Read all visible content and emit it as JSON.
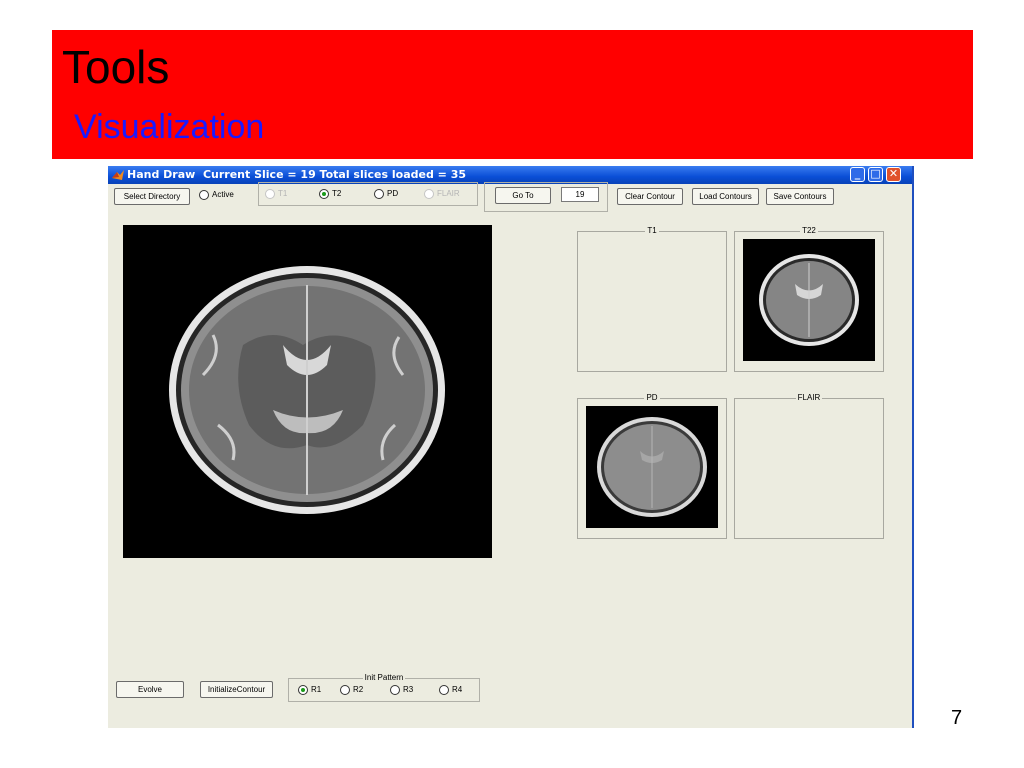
{
  "slide": {
    "title": "Tools",
    "subtitle": "Visualization",
    "page_number": "7",
    "banner_color": "#ff0000"
  },
  "window": {
    "title": "Hand Draw  Current Slice = 19 Total slices loaded = 35",
    "app_icon": "matlab-icon",
    "controls": [
      "minimize-icon",
      "maximize-icon",
      "close-icon"
    ]
  },
  "toolbar": {
    "select_directory": "Select Directory",
    "active_label": "Active",
    "modalities": [
      {
        "label": "T1",
        "selected": false,
        "enabled": false
      },
      {
        "label": "T2",
        "selected": true,
        "enabled": true
      },
      {
        "label": "PD",
        "selected": false,
        "enabled": true
      },
      {
        "label": "FLAIR",
        "selected": false,
        "enabled": false
      }
    ],
    "goto_label": "Go To",
    "goto_value": "19",
    "clear_contour": "Clear Contour",
    "load_contours": "Load Contours",
    "save_contours": "Save Contours"
  },
  "panels": {
    "t1": "T1",
    "t2": "T22",
    "pd": "PD",
    "flair": "FLAIR"
  },
  "bottom": {
    "evolve": "Evolve",
    "initialize_contour": "InitializeContour",
    "init_pattern_label": "Init Pattern",
    "patterns": [
      {
        "label": "R1",
        "selected": true
      },
      {
        "label": "R2",
        "selected": false
      },
      {
        "label": "R3",
        "selected": false
      },
      {
        "label": "R4",
        "selected": false
      }
    ]
  }
}
